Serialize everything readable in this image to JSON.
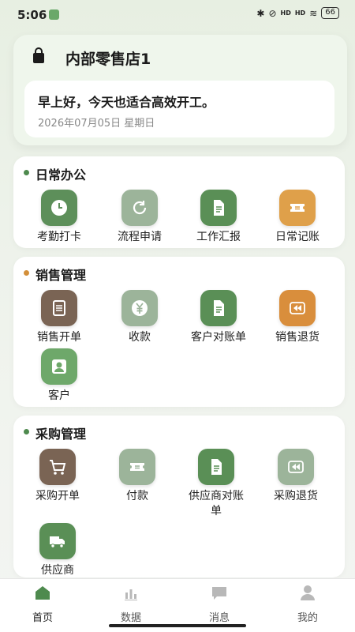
{
  "status_bar": {
    "time": "5:06",
    "network": "HD",
    "battery": "66"
  },
  "header": {
    "store_name": "内部零售店1",
    "greeting": "早上好，今天也适合高效开工。",
    "date": "2026年07月05日 星期日"
  },
  "sections": [
    {
      "title": "日常办公",
      "dot_color": "#4e8a4e",
      "items": [
        {
          "label": "考勤打卡",
          "icon": "clock-icon",
          "color": "#5d8f5a"
        },
        {
          "label": "流程申请",
          "icon": "refresh-icon",
          "color": "#9cb49a"
        },
        {
          "label": "工作汇报",
          "icon": "document-icon",
          "color": "#5a8f56"
        },
        {
          "label": "日常记账",
          "icon": "ticket-icon",
          "color": "#dfa04a"
        }
      ]
    },
    {
      "title": "销售管理",
      "dot_color": "#d38f3a",
      "items": [
        {
          "label": "销售开单",
          "icon": "list-icon",
          "color": "#7a6454"
        },
        {
          "label": "收款",
          "icon": "yen-icon",
          "color": "#9cb49a"
        },
        {
          "label": "客户对账单",
          "icon": "document-icon",
          "color": "#5a8f56"
        },
        {
          "label": "销售退货",
          "icon": "rewind-icon",
          "color": "#d98e3c"
        },
        {
          "label": "客户",
          "icon": "person-icon",
          "color": "#6ea86a"
        }
      ]
    },
    {
      "title": "采购管理",
      "dot_color": "#4e8a4e",
      "items": [
        {
          "label": "采购开单",
          "icon": "cart-icon",
          "color": "#7a6454"
        },
        {
          "label": "付款",
          "icon": "ticket-icon",
          "color": "#9cb49a"
        },
        {
          "label": "供应商对账单",
          "label_line1": "供应商对账",
          "label_line2": "单",
          "icon": "document-icon",
          "color": "#5a8f56"
        },
        {
          "label": "采购退货",
          "icon": "rewind-icon",
          "color": "#9cb49a"
        },
        {
          "label": "供应商",
          "icon": "truck-icon",
          "color": "#5a8f56"
        }
      ]
    }
  ],
  "nav": {
    "items": [
      {
        "label": "首页",
        "icon": "home-icon",
        "active": true
      },
      {
        "label": "数据",
        "icon": "bar-chart-icon",
        "active": false
      },
      {
        "label": "消息",
        "icon": "message-icon",
        "active": false
      },
      {
        "label": "我的",
        "icon": "user-icon",
        "active": false
      }
    ],
    "active_color": "#4e8a4e",
    "inactive_color": "#b8b8b8"
  }
}
